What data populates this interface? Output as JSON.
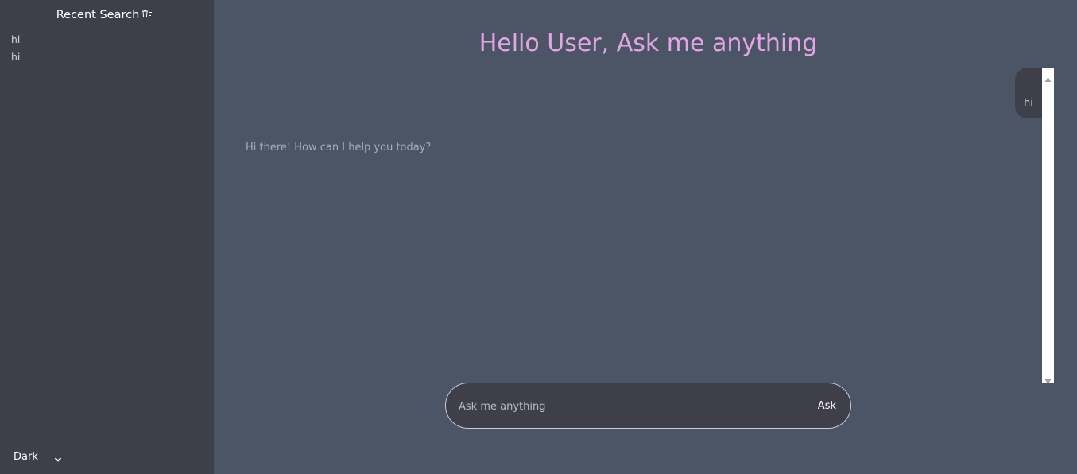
{
  "sidebar": {
    "title": "Recent Search",
    "clear_icon": "trash-icon",
    "history": [
      "hi",
      "hi"
    ],
    "theme_select": {
      "selected": "Dark",
      "options": [
        "Dark"
      ]
    }
  },
  "main": {
    "title": "Hello User, Ask me anything",
    "messages": {
      "user": "hi",
      "bot": "Hi there! How can I help you today?"
    },
    "input": {
      "placeholder": "Ask me anything",
      "value": ""
    },
    "ask_label": "Ask"
  },
  "colors": {
    "sidebar_bg": "#3f3f49",
    "main_bg": "#4b5566",
    "title": "#e3a6e4"
  }
}
